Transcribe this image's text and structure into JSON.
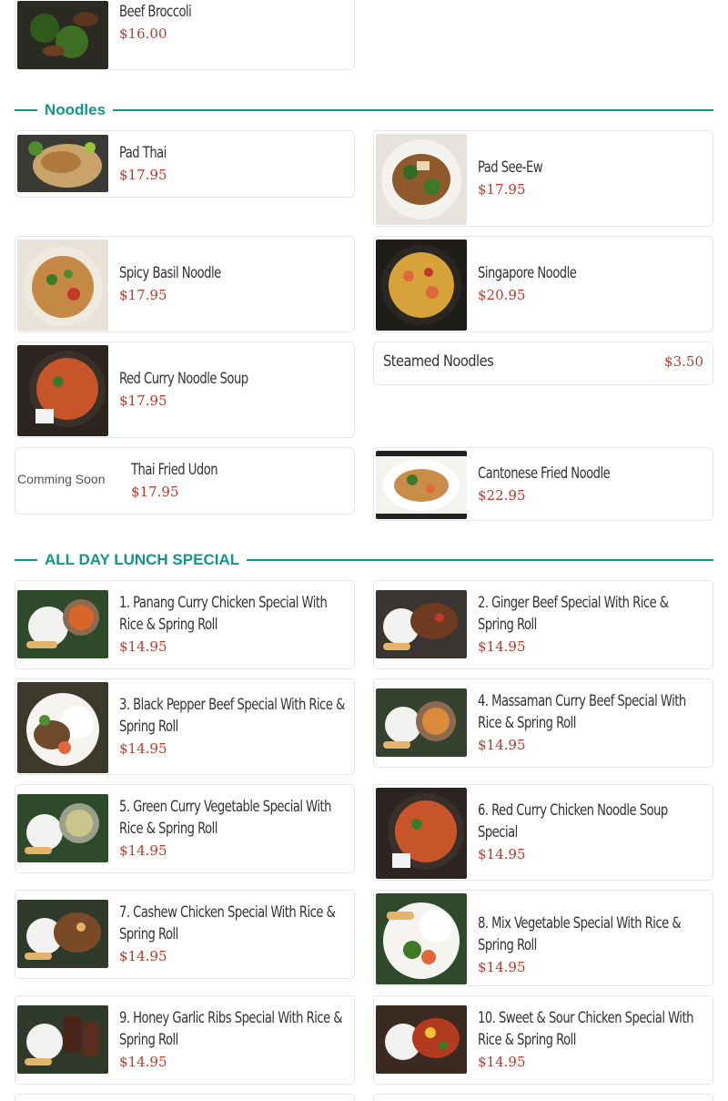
{
  "sections": {
    "noodles": "Noodles",
    "lunch": "ALL DAY LUNCH SPECIAL"
  },
  "items": {
    "beef_broccoli": {
      "name": "Beef Broccoli",
      "price": "$16.00"
    },
    "pad_thai": {
      "name": "Pad Thai",
      "price": "$17.95"
    },
    "pad_see_ew": {
      "name": "Pad See-Ew",
      "price": "$17.95"
    },
    "spicy_basil": {
      "name": "Spicy Basil Noodle",
      "price": "$17.95"
    },
    "singapore": {
      "name": "Singapore Noodle",
      "price": "$20.95"
    },
    "red_curry_soup": {
      "name": "Red Curry Noodle Soup",
      "price": "$17.95"
    },
    "steamed": {
      "name": "Steamed Noodles",
      "price": "$3.50"
    },
    "thai_udon": {
      "name": "Thai Fried Udon",
      "price": "$17.95",
      "alt": "Comming Soon"
    },
    "cantonese": {
      "name": "Cantonese Fried Noodle",
      "price": "$22.95"
    },
    "l1": {
      "name": "1. Panang Curry Chicken Special With Rice & Spring Roll",
      "price": "$14.95"
    },
    "l2": {
      "name": "2. Ginger Beef Special With Rice & Spring Roll",
      "price": "$14.95"
    },
    "l3": {
      "name": "3. Black Pepper Beef Special With Rice & Spring Roll",
      "price": "$14.95"
    },
    "l4": {
      "name": "4. Massaman Curry Beef Special With Rice & Spring Roll",
      "price": "$14.95"
    },
    "l5": {
      "name": "5. Green Curry Vegetable Special With Rice & Spring Roll",
      "price": "$14.95"
    },
    "l6": {
      "name": "6. Red Curry Chicken Noodle Soup Special",
      "price": "$14.95"
    },
    "l7": {
      "name": "7. Cashew Chicken Special With Rice & Spring Roll",
      "price": "$14.95"
    },
    "l8": {
      "name": "8. Mix Vegetable Special With Rice & Spring Roll",
      "price": "$14.95"
    },
    "l9": {
      "name": "9. Honey Garlic Ribs Special With Rice & Spring Roll",
      "price": "$14.95"
    },
    "l10": {
      "name": "10. Sweet & Sour Chicken Special With Rice & Spring Roll",
      "price": "$14.95"
    }
  },
  "colors": {
    "accent": "#12968c",
    "price": "#c0392b"
  },
  "icons": [
    "food-photo"
  ]
}
